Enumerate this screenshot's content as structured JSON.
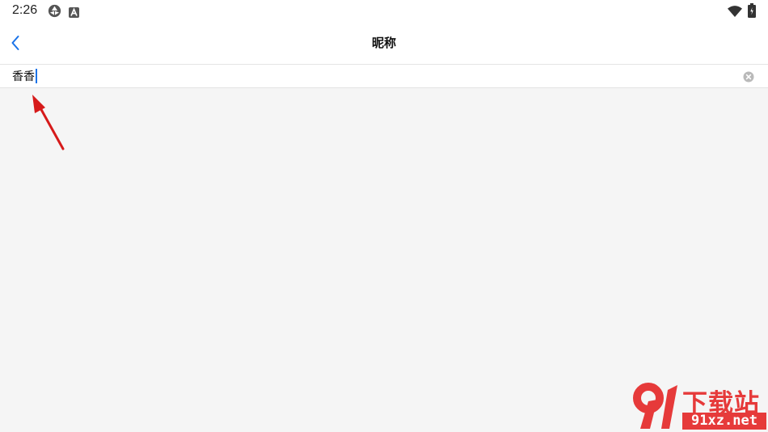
{
  "status_bar": {
    "time": "2:26",
    "left_icons": [
      "circle-arrows-icon",
      "a-square-icon"
    ],
    "right_icons": [
      "wifi-icon",
      "battery-icon"
    ]
  },
  "header": {
    "title": "昵称",
    "back_icon": "chevron-left-icon"
  },
  "nickname_field": {
    "value": "香香",
    "clear_icon": "clear-circle-icon"
  },
  "watermark": {
    "mark": "9",
    "title": "下载站",
    "domain": "91xz.net"
  },
  "colors": {
    "accent": "#1a73e8",
    "annotation": "#d61a1a",
    "watermark": "#e63a3a",
    "background": "#f5f5f5",
    "surface": "#ffffff"
  }
}
